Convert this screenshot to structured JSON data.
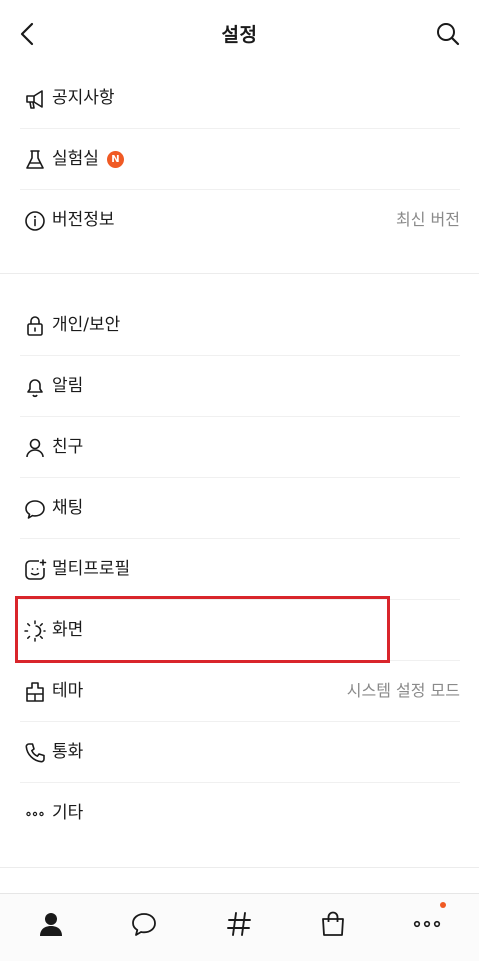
{
  "header": {
    "title": "설정",
    "back_icon": "chevron-left-icon",
    "search_icon": "search-icon"
  },
  "section1": {
    "items": [
      {
        "label": "공지사항",
        "icon": "megaphone-icon"
      },
      {
        "label": "실험실",
        "icon": "flask-icon",
        "badge": "N"
      },
      {
        "label": "버전정보",
        "icon": "info-icon",
        "value": "최신 버전"
      }
    ]
  },
  "section2": {
    "items": [
      {
        "label": "개인/보안",
        "icon": "lock-icon"
      },
      {
        "label": "알림",
        "icon": "bell-icon"
      },
      {
        "label": "친구",
        "icon": "person-icon"
      },
      {
        "label": "채팅",
        "icon": "chat-bubble-icon"
      },
      {
        "label": "멀티프로필",
        "icon": "multi-profile-icon"
      },
      {
        "label": "화면",
        "icon": "display-brightness-icon"
      },
      {
        "label": "테마",
        "icon": "theme-icon",
        "value": "시스템 설정 모드"
      },
      {
        "label": "통화",
        "icon": "phone-icon"
      },
      {
        "label": "기타",
        "icon": "more-horizontal-icon"
      }
    ]
  },
  "highlight_color": "#d9252b",
  "accent_color": "#f05a24",
  "tabbar": {
    "tabs": [
      {
        "icon": "friends-tab-icon",
        "active": true
      },
      {
        "icon": "chats-tab-icon"
      },
      {
        "icon": "hashtag-tab-icon"
      },
      {
        "icon": "shopping-tab-icon"
      },
      {
        "icon": "more-tab-icon",
        "dot": true
      }
    ]
  }
}
